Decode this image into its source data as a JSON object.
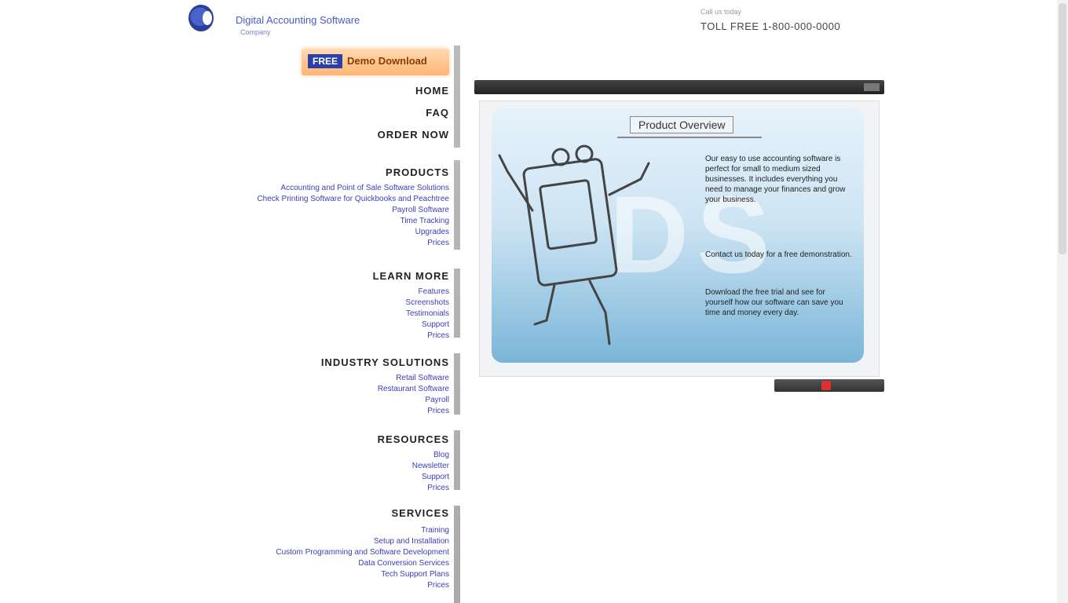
{
  "header": {
    "logo_text": "Digital Accounting Software",
    "logo_sub": "Company",
    "right_small": "Call us today",
    "right_big": "TOLL FREE 1-800-000-0000"
  },
  "sidebar": {
    "cta_tag": "FREE",
    "cta_text": "Demo Download",
    "sections": [
      {
        "head": "HOME",
        "links": []
      },
      {
        "head": "FAQ",
        "links": []
      },
      {
        "head": "ORDER NOW",
        "links": []
      },
      {
        "head": "PRODUCTS",
        "links": [
          "Accounting and Point of Sale Software Solutions",
          "Check Printing Software for Quickbooks and Peachtree",
          "Payroll Software",
          "Time Tracking",
          "Upgrades",
          "Prices"
        ]
      },
      {
        "head": "LEARN MORE",
        "links": [
          "Features",
          "Screenshots",
          "Testimonials",
          "Support",
          "Prices"
        ]
      },
      {
        "head": "INDUSTRY SOLUTIONS",
        "links": [
          "Retail Software",
          "Restaurant Software",
          "Payroll",
          "Prices"
        ]
      },
      {
        "head": "RESOURCES",
        "links": [
          "Blog",
          "Newsletter",
          "Support",
          "Prices"
        ]
      },
      {
        "head": "SERVICES",
        "links": [
          "Training",
          "Setup and Installation",
          "Custom Programming and Software Development",
          "Data Conversion Services",
          "Tech Support Plans",
          "Prices"
        ]
      }
    ]
  },
  "main": {
    "panel_title": "Product Overview",
    "watermark": "DS",
    "paragraphs": [
      "Our easy to use accounting software is perfect for small to medium sized businesses. It includes everything you need to manage your finances and grow your business.",
      "Contact us today for a free demonstration.",
      "Download the free trial and see for yourself how our software can save you time and money every day."
    ]
  },
  "colors": {
    "cta": "#ffb573",
    "link": "#3a3fb5",
    "panel_top": "#e6f2fb",
    "panel_bottom": "#7ab6d8",
    "footer_red": "#e03030"
  }
}
